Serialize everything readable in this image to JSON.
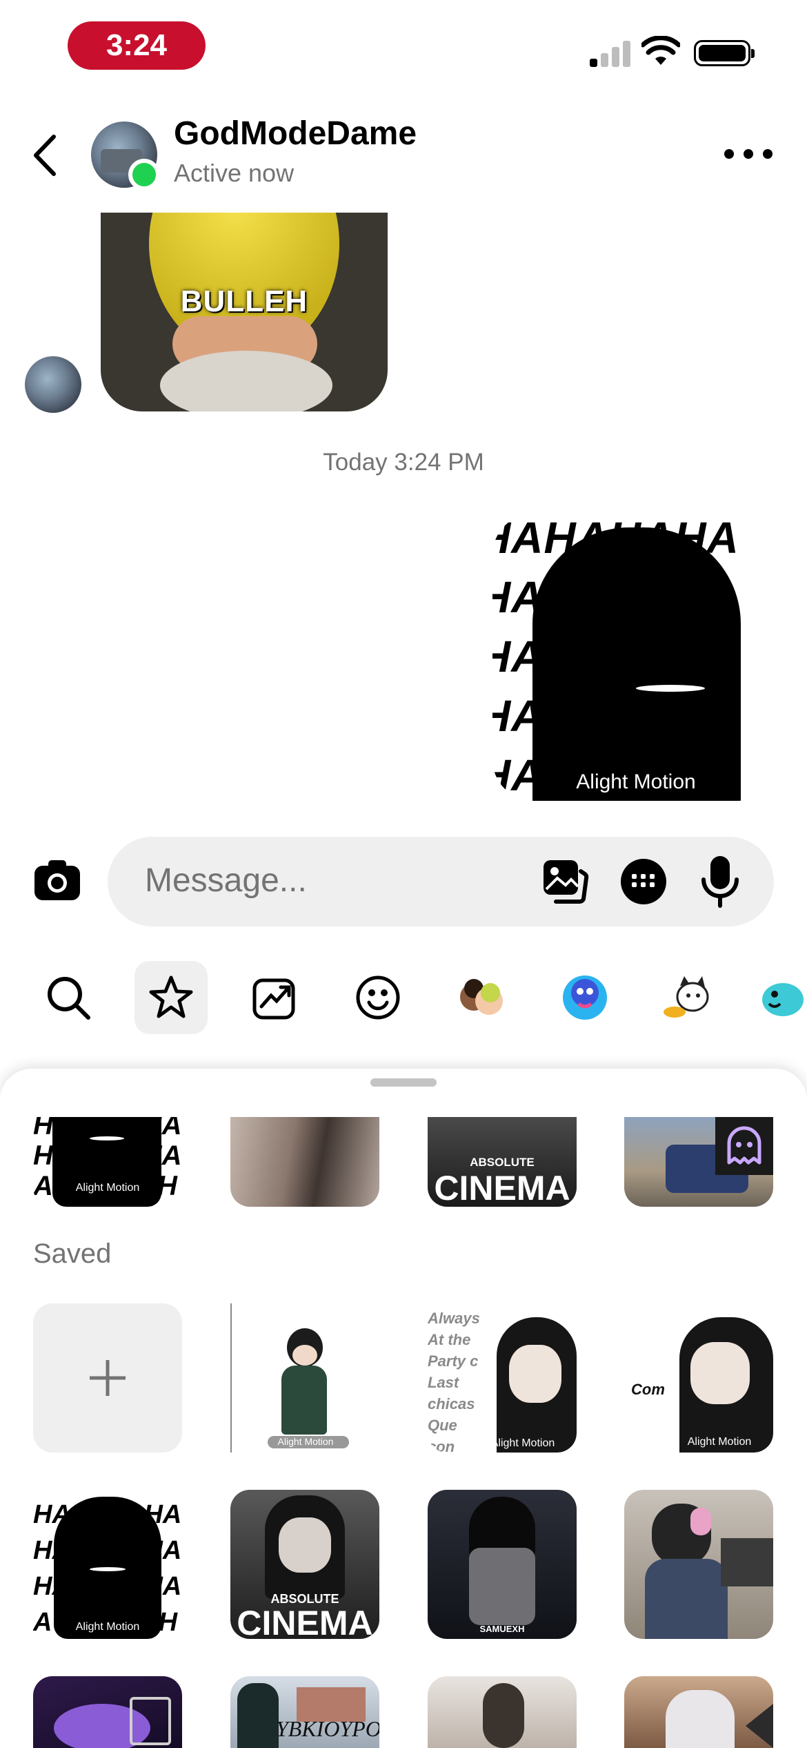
{
  "status_bar": {
    "time": "3:24"
  },
  "header": {
    "name": "GodModeDame",
    "status": "Active now"
  },
  "messages": {
    "received_caption": "BULLEH",
    "timestamp": "Today 3:24 PM",
    "sent_text": "HAHAHAHA",
    "watermark": "Alight Motion"
  },
  "composer": {
    "placeholder": "Message..."
  },
  "sheet": {
    "saved_label": "Saved",
    "cinema_small": "ABSOLUTE",
    "cinema_big": "CINEMA",
    "watermark": "Alight Motion",
    "caption_lines": [
      "Always",
      "At the",
      "Party c",
      "Last",
      "chicas",
      "Que",
      "con"
    ],
    "com_text": "Com",
    "samuexh": "SAMUEXH",
    "ybk": "YBKIOYPOS"
  },
  "colors": {
    "online": "#1fd150",
    "time_pill": "#c8102e"
  }
}
